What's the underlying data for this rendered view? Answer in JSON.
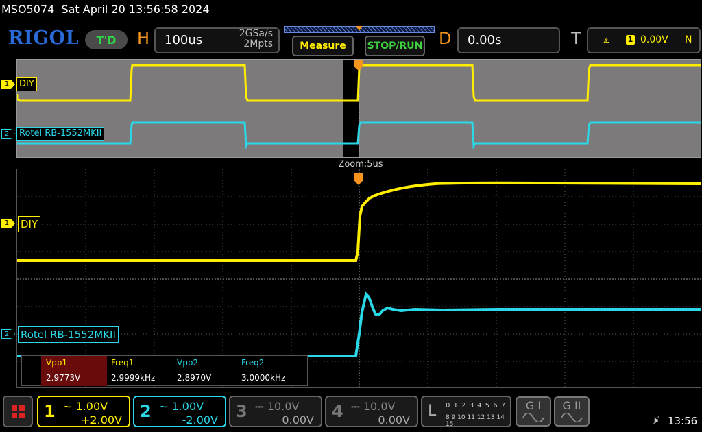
{
  "status": {
    "model": "MSO5074",
    "datetime": "Sat April 20 13:56:58 2024"
  },
  "toolbar": {
    "brand": "RIGOL",
    "td_label": "T'D",
    "horizontal": {
      "letter": "H",
      "timebase": "100us",
      "sample_rate": "2GSa/s",
      "memory_depth": "2Mpts"
    },
    "measure_label": "Measure",
    "stoprun_label": "STOP/RUN",
    "delay": {
      "letter": "D",
      "value": "0.00s"
    },
    "trigger": {
      "letter": "T",
      "edge_icon": "rising-edge-icon",
      "channel": "1",
      "level": "0.00V",
      "mode": "N"
    }
  },
  "display": {
    "zoom_label": "Zoom:5us",
    "overview": {
      "ch1_marker": "1",
      "ch1_label": "DIY",
      "ch2_marker": "2",
      "ch2_label": "Rotel RB-1552MKII"
    },
    "zoom": {
      "ch1_marker": "1",
      "ch1_label": "DIY",
      "ch2_marker": "2",
      "ch2_label": "Rotel RB-1552MKII"
    }
  },
  "measurements": {
    "vpp1": {
      "label": "Vpp1",
      "value": "2.9773V"
    },
    "freq1": {
      "label": "Freq1",
      "value": "2.9999kHz"
    },
    "vpp2": {
      "label": "Vpp2",
      "value": "2.8970V"
    },
    "freq2": {
      "label": "Freq2",
      "value": "3.0000kHz"
    }
  },
  "channels": [
    {
      "number": "1",
      "coupling_icon": "ac-coupling-icon",
      "scale": "1.00V",
      "offset": "+2.00V",
      "color": "#ffee00",
      "active": true
    },
    {
      "number": "2",
      "coupling_icon": "ac-coupling-icon",
      "scale": "1.00V",
      "offset": "-2.00V",
      "color": "#2ad8e8",
      "active": true
    },
    {
      "number": "3",
      "coupling_icon": "dc-coupling-icon",
      "scale": "10.0V",
      "offset": "0.00V",
      "color": "#888888",
      "active": false
    },
    {
      "number": "4",
      "coupling_icon": "dc-coupling-icon",
      "scale": "10.0V",
      "offset": "0.00V",
      "color": "#888888",
      "active": false
    }
  ],
  "logic": {
    "letter": "L",
    "row1": "0 1 2 3  4 5 6 7",
    "row2": "8 9 10 11 12 13 14 15"
  },
  "generators": [
    {
      "label": "G I"
    },
    {
      "label": "G II"
    }
  ],
  "system": {
    "time": "13:56",
    "speaker_icon": "speaker-muted-icon"
  },
  "colors": {
    "ch1": "#ffee00",
    "ch2": "#2ad8e8",
    "trigger": "#f7941d",
    "brand": "#2a6ad8",
    "measure_highlight": "#6a0b0b"
  }
}
